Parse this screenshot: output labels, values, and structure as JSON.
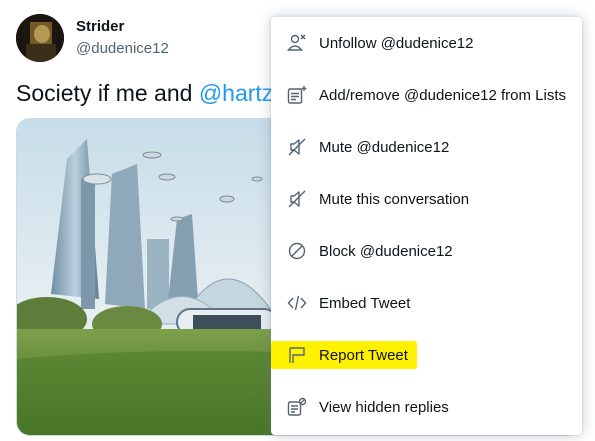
{
  "tweet": {
    "display_name": "Strider",
    "handle": "@dudenice12",
    "text_prefix": "Society if me and ",
    "mention": "@hartz"
  },
  "menu": {
    "items": [
      {
        "label": "Unfollow @dudenice12",
        "icon": "unfollow-icon"
      },
      {
        "label": "Add/remove @dudenice12 from Lists",
        "icon": "list-add-icon"
      },
      {
        "label": "Mute @dudenice12",
        "icon": "mute-icon"
      },
      {
        "label": "Mute this conversation",
        "icon": "mute-conversation-icon"
      },
      {
        "label": "Block @dudenice12",
        "icon": "block-icon"
      },
      {
        "label": "Embed Tweet",
        "icon": "embed-icon"
      },
      {
        "label": "Report Tweet",
        "icon": "report-flag-icon",
        "highlighted": true
      },
      {
        "label": "View hidden replies",
        "icon": "hidden-replies-icon"
      }
    ]
  },
  "colors": {
    "mention": "#1d9bf0",
    "highlight": "#fff200",
    "text": "#0f1419",
    "secondary": "#536471"
  }
}
